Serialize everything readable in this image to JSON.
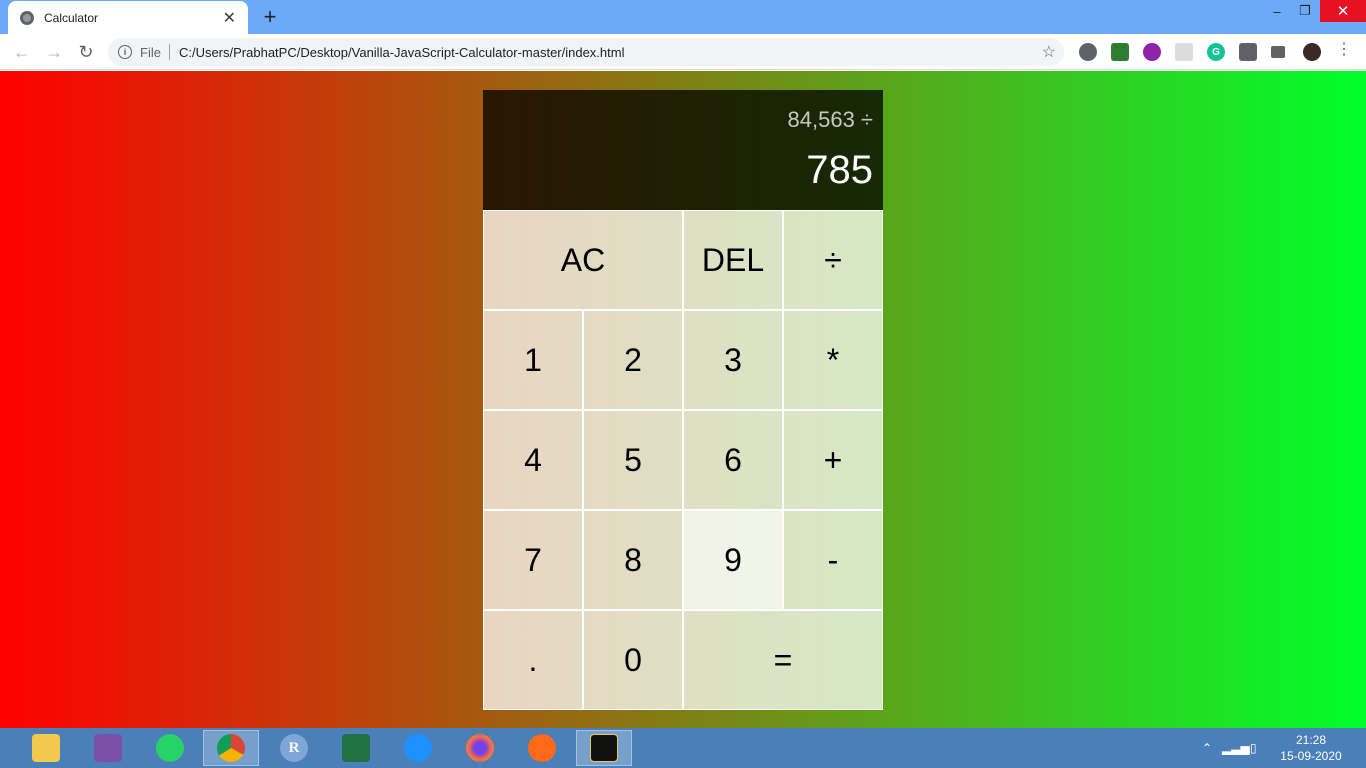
{
  "browser": {
    "tab_title": "Calculator",
    "tab_close": "✕",
    "new_tab": "+",
    "omnibox_scheme": "File",
    "url": "C:/Users/PrabhatPC/Desktop/Vanilla-JavaScript-Calculator-master/index.html",
    "star_icon": "☆",
    "minimize": "–",
    "restore": "❐",
    "close": "✕",
    "back": "←",
    "forward": "→",
    "reload": "↻",
    "menu": "⋮"
  },
  "calculator": {
    "previous_operand": "84,563 ÷",
    "current_operand": "785",
    "keys": {
      "ac": "AC",
      "del": "DEL",
      "divide": "÷",
      "k1": "1",
      "k2": "2",
      "k3": "3",
      "multiply": "*",
      "k4": "4",
      "k5": "5",
      "k6": "6",
      "plus": "+",
      "k7": "7",
      "k8": "8",
      "k9": "9",
      "minus": "-",
      "dot": ".",
      "k0": "0",
      "equals": "="
    }
  },
  "taskbar": {
    "r_label": "R",
    "clock_time": "21:28",
    "clock_date": "15-09-2020"
  },
  "colors": {
    "page_gradient_start": "#ff0000",
    "page_gradient_end": "#00ff2a",
    "tabstrip": "#6aaaf6",
    "taskbar": "#4a7fba"
  }
}
